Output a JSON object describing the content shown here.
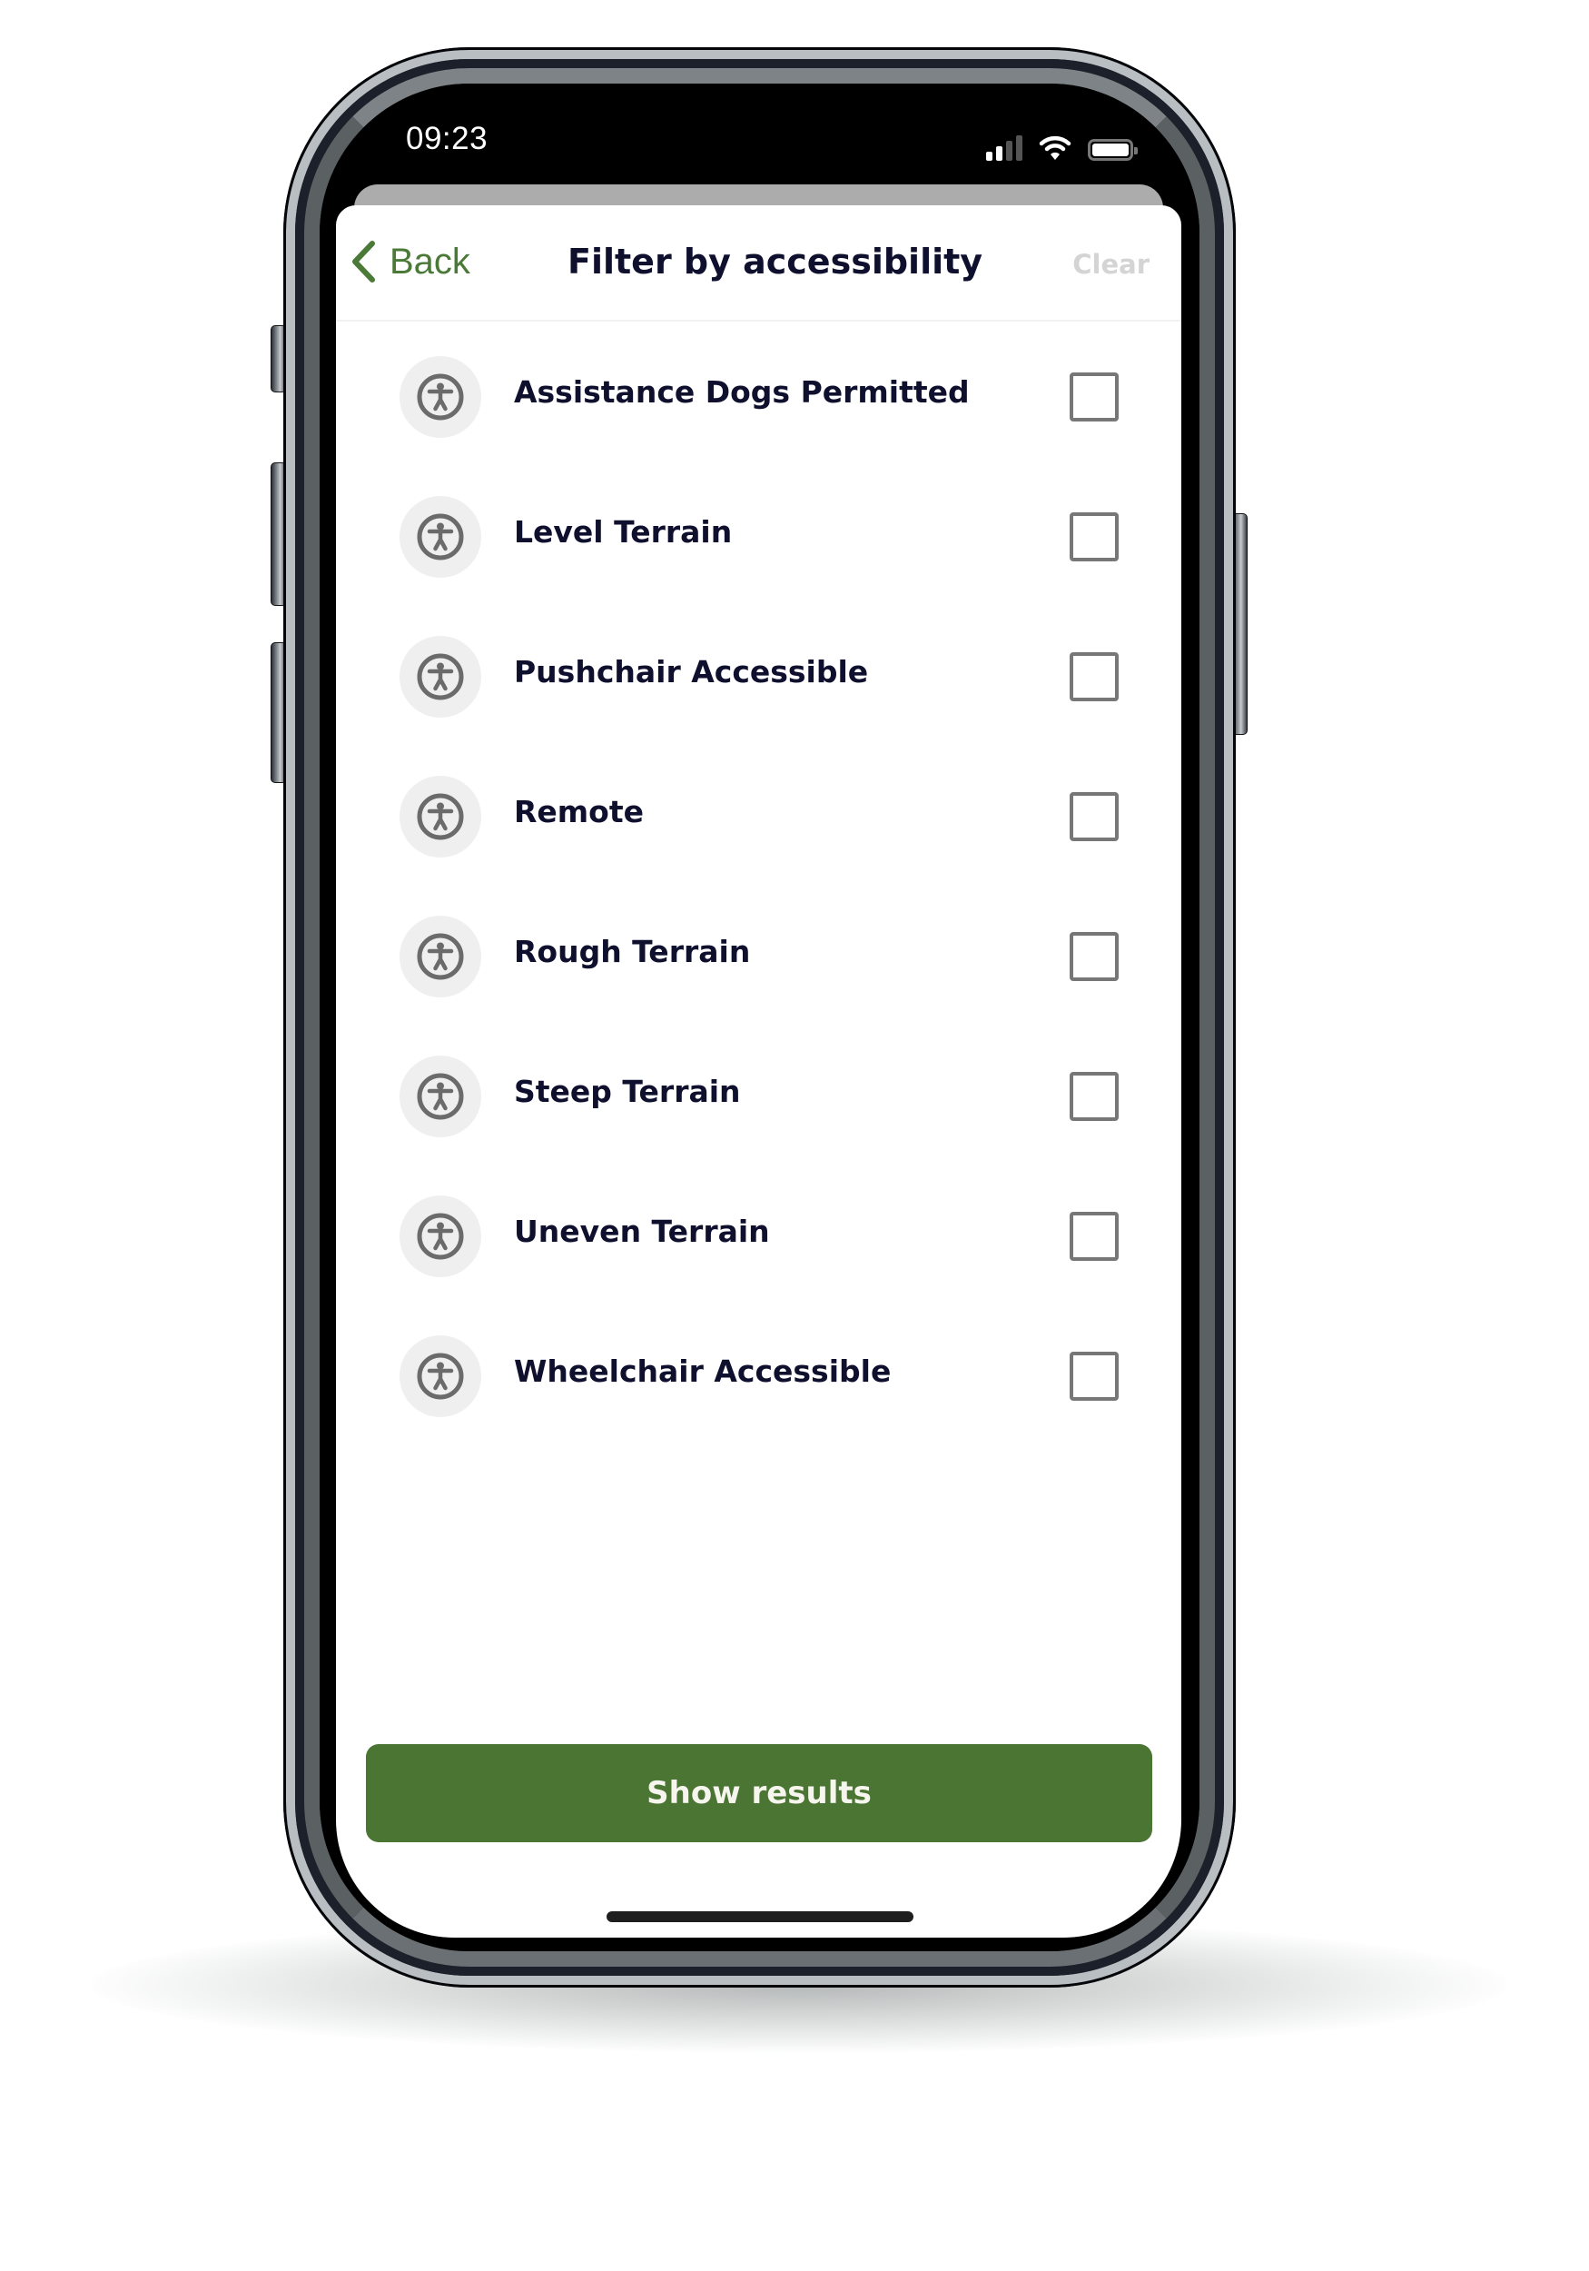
{
  "status_bar": {
    "time": "09:23",
    "signal_bars_total": 4,
    "signal_bars_active": 2,
    "wifi": "wifi-icon",
    "battery_level": 1.0
  },
  "header": {
    "back_label": "Back",
    "title": "Filter by accessibility",
    "clear_label": "Clear"
  },
  "filters": [
    {
      "label": "Assistance Dogs Permitted",
      "icon": "accessibility-icon",
      "checked": false
    },
    {
      "label": "Level Terrain",
      "icon": "accessibility-icon",
      "checked": false
    },
    {
      "label": "Pushchair Accessible",
      "icon": "accessibility-icon",
      "checked": false
    },
    {
      "label": "Remote",
      "icon": "accessibility-icon",
      "checked": false
    },
    {
      "label": "Rough Terrain",
      "icon": "accessibility-icon",
      "checked": false
    },
    {
      "label": "Steep Terrain",
      "icon": "accessibility-icon",
      "checked": false
    },
    {
      "label": "Uneven Terrain",
      "icon": "accessibility-icon",
      "checked": false
    },
    {
      "label": "Wheelchair Accessible",
      "icon": "accessibility-icon",
      "checked": false
    }
  ],
  "footer": {
    "show_results_label": "Show results"
  },
  "colors": {
    "accent_green": "#4a7533",
    "back_green": "#4b7a38",
    "text_dark": "#0f0f2e",
    "clear_disabled": "#d4d4d4",
    "icon_grey": "#6b6b6b",
    "icon_bg": "#efefef",
    "checkbox_border": "#777777"
  }
}
